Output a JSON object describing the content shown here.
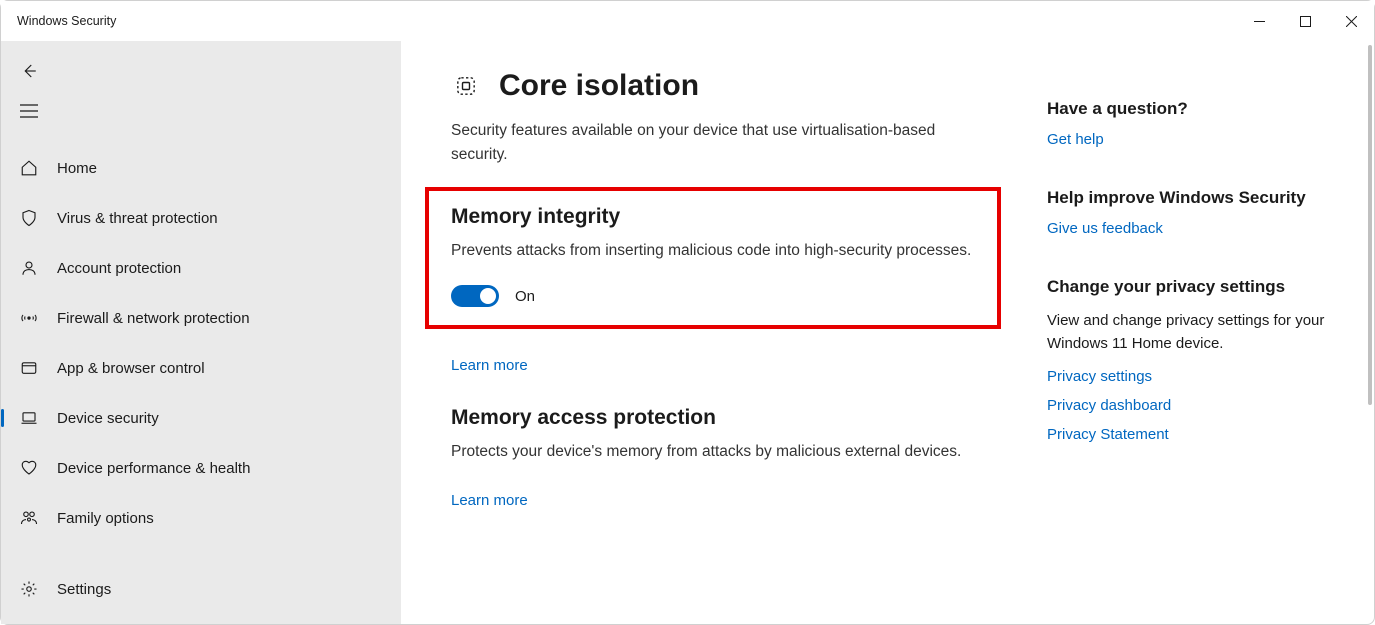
{
  "window": {
    "title": "Windows Security"
  },
  "sidebar": {
    "items": [
      {
        "label": "Home"
      },
      {
        "label": "Virus & threat protection"
      },
      {
        "label": "Account protection"
      },
      {
        "label": "Firewall & network protection"
      },
      {
        "label": "App & browser control"
      },
      {
        "label": "Device security"
      },
      {
        "label": "Device performance & health"
      },
      {
        "label": "Family options"
      }
    ],
    "settings_label": "Settings"
  },
  "page": {
    "title": "Core isolation",
    "description": "Security features available on your device that use virtualisation-based security."
  },
  "memory_integrity": {
    "title": "Memory integrity",
    "description": "Prevents attacks from inserting malicious code into high-security processes.",
    "toggle_state": "On",
    "learn_more": "Learn more"
  },
  "memory_access": {
    "title": "Memory access protection",
    "description": "Protects your device's memory from attacks by malicious external devices.",
    "learn_more": "Learn more"
  },
  "aux": {
    "question_head": "Have a question?",
    "get_help": "Get help",
    "improve_head": "Help improve Windows Security",
    "feedback": "Give us feedback",
    "privacy_head": "Change your privacy settings",
    "privacy_text": "View and change privacy settings for your Windows 11 Home device.",
    "privacy_settings": "Privacy settings",
    "privacy_dashboard": "Privacy dashboard",
    "privacy_statement": "Privacy Statement"
  }
}
